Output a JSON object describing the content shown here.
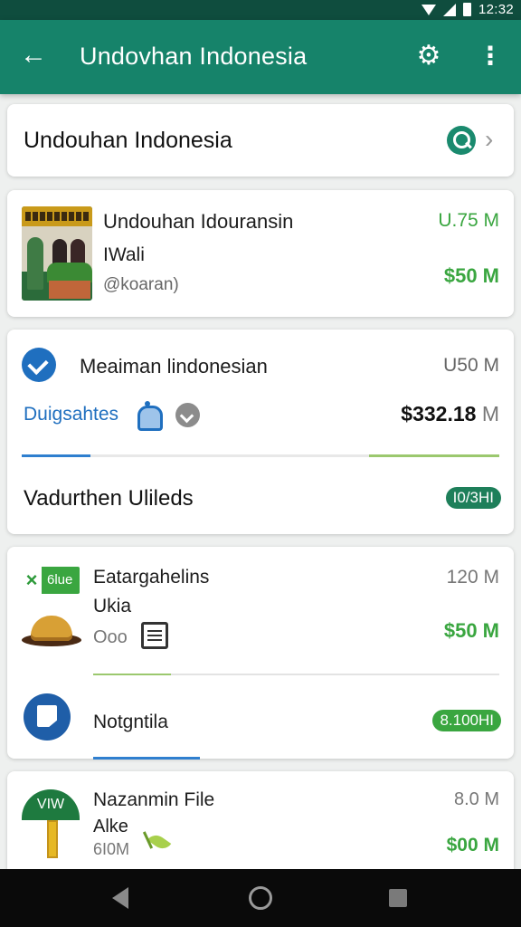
{
  "status_bar": {
    "time": "12:32",
    "icons": [
      "wifi-icon",
      "signal-icon",
      "battery-icon"
    ]
  },
  "app_bar": {
    "title": "Undovhan Indonesia",
    "icons": [
      "back-arrow-icon",
      "settings-gear-icon",
      "more-vert-icon"
    ],
    "color": "#16836a"
  },
  "search_card": {
    "title": "Undouhan Indonesia",
    "icons": [
      "search-icon",
      "chevron-right-icon"
    ]
  },
  "featured": {
    "name": "Undouhan Idouransin",
    "subtitle": "IWali",
    "handle": "@koaran)",
    "size": "U.75 M",
    "price": "$50 M",
    "thumbnail_icon": "group-photo"
  },
  "card_three": {
    "name": "Meaiman lindonesian",
    "size": "U50 M",
    "link_text": "Duigsahtes",
    "amount": "$332.18",
    "amount_unit": "M",
    "section_title": "Vadurthen Ulileds",
    "section_badge": "I0/3HI",
    "icons": [
      "verified-badge-icon",
      "bell-icon",
      "globe-icon"
    ]
  },
  "card_four": {
    "logo_text": "6lue",
    "name": "Eatargahelins",
    "size": "120 M",
    "subtitle": "Ukia",
    "meta": "Ooo",
    "price": "$50 M",
    "item_name": "Notgntila",
    "item_badge": "8.100HI",
    "icons": [
      "excel-logo-icon",
      "food-dish-icon",
      "document-icon",
      "book-circle-icon"
    ]
  },
  "card_five": {
    "logo_text": "VIW",
    "name": "Nazanmin File",
    "size": "8.0 M",
    "subtitle": "Alke",
    "meta": "6I0M",
    "price": "$00 M",
    "icons": [
      "signpost-icon",
      "leaf-icon"
    ]
  },
  "nav_bar": {
    "icons": [
      "nav-back-icon",
      "nav-home-icon",
      "nav-recents-icon"
    ]
  },
  "colors": {
    "primary": "#16836a",
    "status_bar": "#0f4d3e",
    "price_green": "#3aa640",
    "link_blue": "#1f6fbf"
  }
}
